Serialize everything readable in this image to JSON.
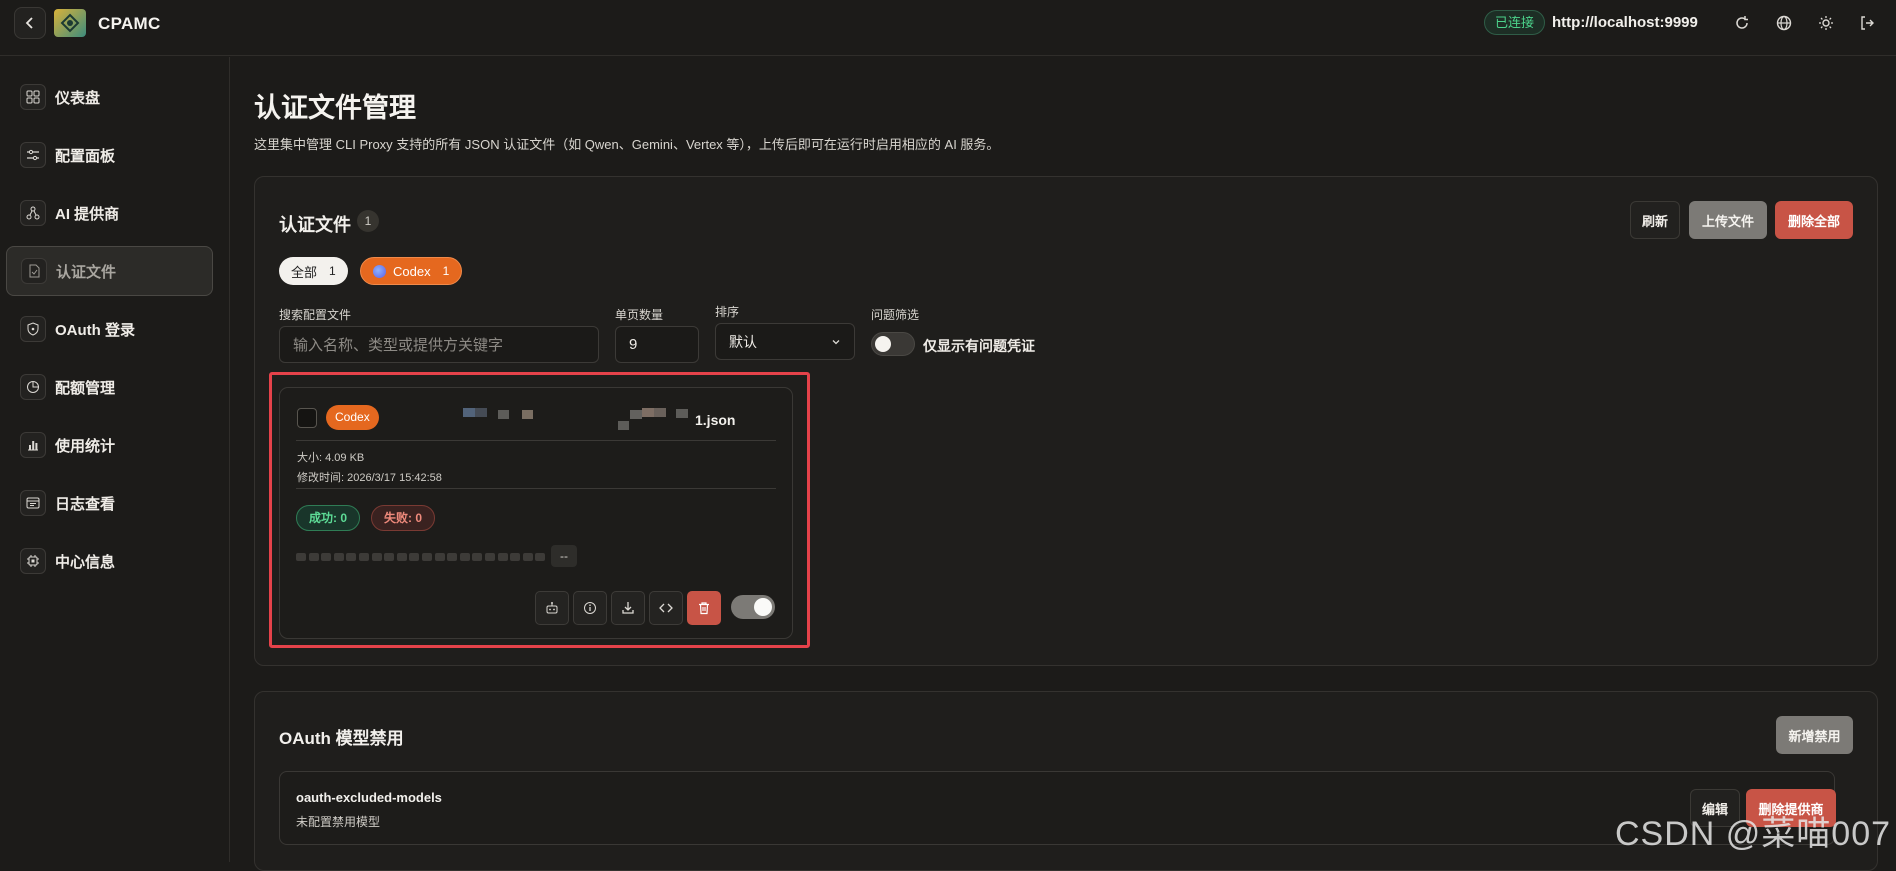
{
  "app": {
    "brand": "CPAMC",
    "connection_status": "已连接",
    "server_url": "http://localhost:9999"
  },
  "topbar_icons": [
    "back-icon",
    "refresh-icon",
    "globe-icon",
    "sun-icon",
    "logout-icon"
  ],
  "sidebar": {
    "items": [
      {
        "label": "仪表盘",
        "icon": "dashboard-icon"
      },
      {
        "label": "配置面板",
        "icon": "sliders-icon"
      },
      {
        "label": "AI 提供商",
        "icon": "network-icon"
      },
      {
        "label": "认证文件",
        "icon": "file-check-icon",
        "active": true
      },
      {
        "label": "OAuth 登录",
        "icon": "shield-icon"
      },
      {
        "label": "配额管理",
        "icon": "pie-chart-icon"
      },
      {
        "label": "使用统计",
        "icon": "bar-chart-icon"
      },
      {
        "label": "日志查看",
        "icon": "terminal-icon"
      },
      {
        "label": "中心信息",
        "icon": "cpu-icon"
      }
    ]
  },
  "page": {
    "title": "认证文件管理",
    "description": "这里集中管理 CLI Proxy 支持的所有 JSON 认证文件（如 Qwen、Gemini、Vertex 等），上传后即可在运行时启用相应的 AI 服务。"
  },
  "auth_files": {
    "title": "认证文件",
    "count": "1",
    "actions": {
      "refresh": "刷新",
      "upload": "上传文件",
      "delete_all": "删除全部"
    },
    "filters": [
      {
        "label": "全部",
        "count": "1"
      },
      {
        "label": "Codex",
        "count": "1"
      }
    ],
    "search": {
      "label": "搜索配置文件",
      "placeholder": "输入名称、类型或提供方关键字"
    },
    "page_size": {
      "label": "单页数量",
      "value": "9"
    },
    "sort": {
      "label": "排序",
      "value": "默认"
    },
    "problem_filter": {
      "label": "问题筛选",
      "toggle_label": "仅显示有问题凭证",
      "enabled": false
    },
    "file": {
      "type": "Codex",
      "name_suffix": "1.json",
      "size": "大小: 4.09 KB",
      "modified": "修改时间: 2026/3/17 15:42:58",
      "success": "成功: 0",
      "failure": "失败: 0",
      "status_tag": "--",
      "enabled": true,
      "action_icons": [
        "bot-icon",
        "info-icon",
        "download-icon",
        "code-icon",
        "trash-icon"
      ]
    }
  },
  "oauth_excluded": {
    "title": "OAuth 模型禁用",
    "add_button": "新增禁用",
    "item_name": "oauth-excluded-models",
    "item_sub": "未配置禁用模型",
    "edit_button": "编辑",
    "delete_button": "删除提供商"
  },
  "watermark": "CSDN @菜喵007",
  "colors": {
    "background": "#1c1b19",
    "accent_orange": "#e5681f",
    "danger_red": "#c85446",
    "success_green": "#5ddb96",
    "highlight_red": "#e5424a"
  }
}
